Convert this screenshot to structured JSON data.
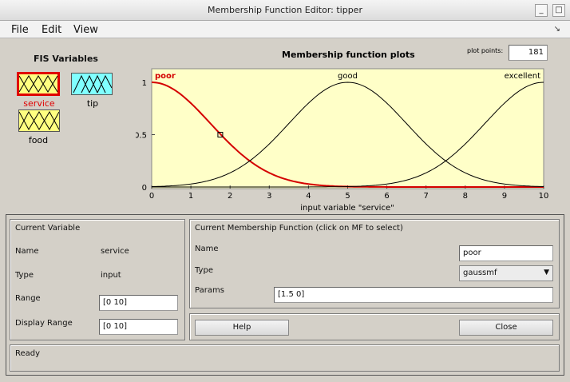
{
  "window": {
    "title": "Membership Function Editor: tipper"
  },
  "menu": [
    "File",
    "Edit",
    "View"
  ],
  "fis_variables": {
    "heading": "FIS Variables",
    "items": [
      {
        "label": "service",
        "color": "#ffff80",
        "selected": true
      },
      {
        "label": "tip",
        "color": "#80ffff",
        "selected": false
      },
      {
        "label": "food",
        "color": "#ffff80",
        "selected": false
      }
    ]
  },
  "plot": {
    "title": "Membership function plots",
    "plot_points_label": "plot points:",
    "plot_points_value": "181",
    "xlabel": "input variable \"service\"",
    "mf_labels": {
      "poor": "poor",
      "good": "good",
      "excellent": "excellent"
    }
  },
  "chart_data": {
    "type": "line",
    "xlim": [
      0,
      10
    ],
    "ylim": [
      0,
      1
    ],
    "x_ticks": [
      "0",
      "1",
      "2",
      "3",
      "4",
      "5",
      "6",
      "7",
      "8",
      "9",
      "10"
    ],
    "y_ticks": [
      "0",
      "0.5",
      "1"
    ],
    "series": [
      {
        "name": "poor",
        "mf": "gaussmf",
        "sigma": 1.5,
        "center": 0,
        "color": "#d40000",
        "selected": true
      },
      {
        "name": "good",
        "mf": "gaussmf",
        "sigma": 1.5,
        "center": 5,
        "color": "#000000",
        "selected": false
      },
      {
        "name": "excellent",
        "mf": "gaussmf",
        "sigma": 1.5,
        "center": 10,
        "color": "#000000",
        "selected": false
      }
    ],
    "marker": {
      "x": 1.75,
      "y": 0.5
    },
    "background": "#ffffc8"
  },
  "current_variable": {
    "heading": "Current Variable",
    "name_label": "Name",
    "name_value": "service",
    "type_label": "Type",
    "type_value": "input",
    "range_label": "Range",
    "range_value": "[0 10]",
    "display_range_label": "Display Range",
    "display_range_value": "[0 10]"
  },
  "current_mf": {
    "heading": "Current Membership Function (click on MF to select)",
    "name_label": "Name",
    "name_value": "poor",
    "type_label": "Type",
    "type_value": "gaussmf",
    "params_label": "Params",
    "params_value": "[1.5 0]"
  },
  "buttons": {
    "help": "Help",
    "close": "Close"
  },
  "status": "Ready"
}
